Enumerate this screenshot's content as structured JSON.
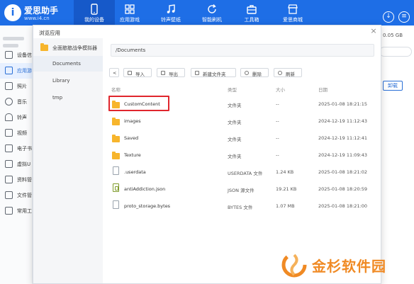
{
  "colors": {
    "brand": "#1e6ee6",
    "accent": "#2a6fd6",
    "folder": "#f7b52c",
    "highlight": "#e0262d",
    "watermark": "#f08a24"
  },
  "app": {
    "name": "爱思助手",
    "url": "www.i4.cn"
  },
  "topnav": [
    {
      "label": "我的设备",
      "icon": "phone-icon"
    },
    {
      "label": "应用游戏",
      "icon": "apps-icon"
    },
    {
      "label": "铃声壁纸",
      "icon": "music-icon"
    },
    {
      "label": "智能刷机",
      "icon": "refresh-icon"
    },
    {
      "label": "工具箱",
      "icon": "toolbox-icon"
    },
    {
      "label": "爱思商城",
      "icon": "store-icon"
    }
  ],
  "sidebar": {
    "items": [
      {
        "label": "设备信",
        "icon": "device-icon"
      },
      {
        "label": "应用游",
        "icon": "apps-icon"
      },
      {
        "label": "照片",
        "icon": "photo-icon"
      },
      {
        "label": "音乐",
        "icon": "music-icon"
      },
      {
        "label": "铃声",
        "icon": "bell-icon"
      },
      {
        "label": "视频",
        "icon": "video-icon"
      },
      {
        "label": "电子书",
        "icon": "book-icon"
      },
      {
        "label": "虚拟U",
        "icon": "usb-icon"
      },
      {
        "label": "资料管",
        "icon": "data-icon"
      },
      {
        "label": "文件管",
        "icon": "folder-icon"
      },
      {
        "label": "常用工",
        "icon": "tools-icon"
      }
    ]
  },
  "background": {
    "size_text": "0.05 GB",
    "uninstall_label": "卸载"
  },
  "dialog": {
    "title": "浏览应用",
    "close": "×",
    "tree": [
      {
        "label": "全面憨憨战争模拟器"
      },
      {
        "label": "Documents"
      },
      {
        "label": "Library"
      },
      {
        "label": "tmp"
      }
    ],
    "path": "/Documents",
    "toolbar": {
      "back": "<",
      "import": "导入",
      "export": "导出",
      "new_folder": "新建文件夹",
      "delete": "删除",
      "refresh": "刷新"
    },
    "columns": {
      "name": "名称",
      "type": "类型",
      "size": "大小",
      "date": "日期"
    },
    "files": [
      {
        "name": "CustomContent",
        "type": "文件夹",
        "size": "--",
        "date": "2025-01-08 18:21:15"
      },
      {
        "name": "images",
        "type": "文件夹",
        "size": "--",
        "date": "2024-12-19 11:12:43"
      },
      {
        "name": "Saved",
        "type": "文件夹",
        "size": "--",
        "date": "2024-12-19 11:12:41"
      },
      {
        "name": "Texture",
        "type": "文件夹",
        "size": "--",
        "date": "2024-12-19 11:09:43"
      },
      {
        "name": ".userdata",
        "type": "USERDATA 文件",
        "size": "1.24 KB",
        "date": "2025-01-08 18:21:02"
      },
      {
        "name": "antiAddiction.json",
        "type": "JSON 源文件",
        "size": "19.21 KB",
        "date": "2025-01-08 18:20:59"
      },
      {
        "name": "proto_storage.bytes",
        "type": "BYTES 文件",
        "size": "1.07 MB",
        "date": "2025-01-08 18:21:00"
      }
    ]
  },
  "watermark": {
    "text": "金杉软件园"
  }
}
